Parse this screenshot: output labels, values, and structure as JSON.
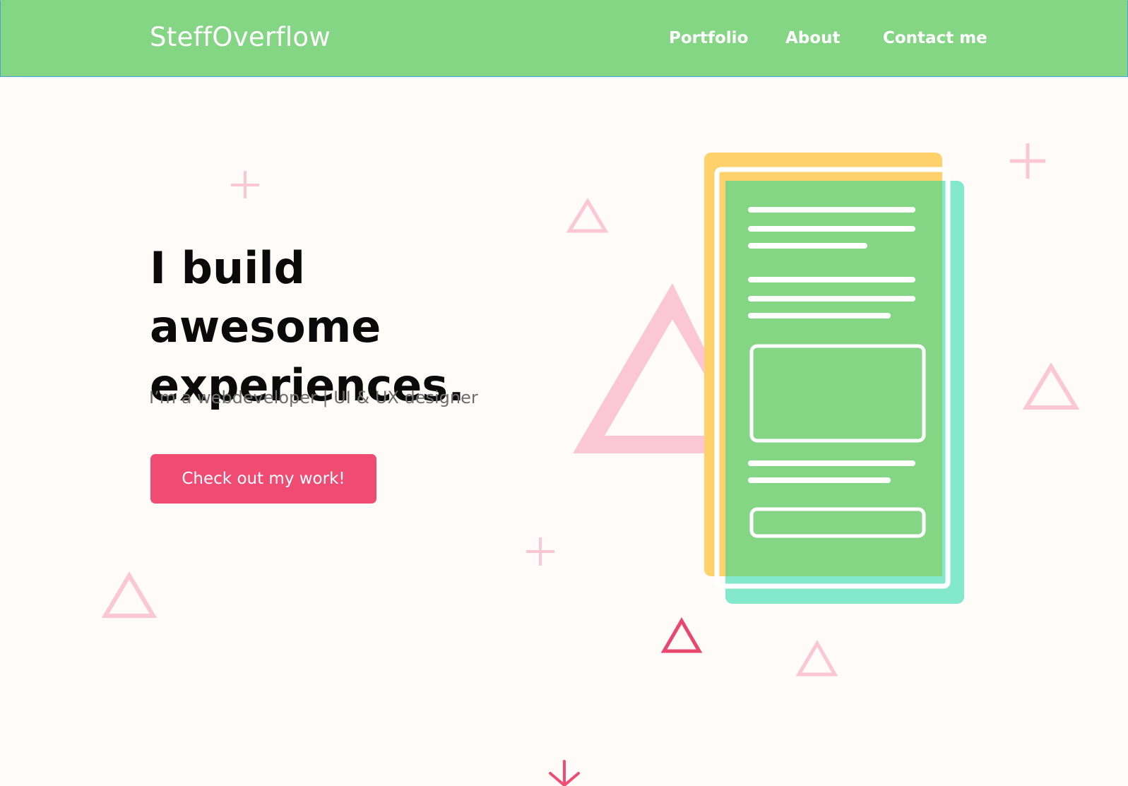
{
  "brand": "SteffOverflow",
  "nav": {
    "items": [
      {
        "label": "Portfolio"
      },
      {
        "label": "About"
      },
      {
        "label": "Contact me"
      }
    ]
  },
  "hero": {
    "headline": "I build awesome experiences.",
    "subtitle": "I’m a webdeveloper | UI & UX designer",
    "cta_label": "Check out my work!"
  },
  "icons": {
    "scroll_down": "arrow-down-icon"
  },
  "colors": {
    "navbar": "#84d684",
    "background": "#fffbf8",
    "accent": "#f04b73",
    "decor_pink": "#fbc7d4",
    "doc_yellow": "#fed16a",
    "doc_teal": "#84e8cc",
    "doc_green": "#84d684"
  }
}
